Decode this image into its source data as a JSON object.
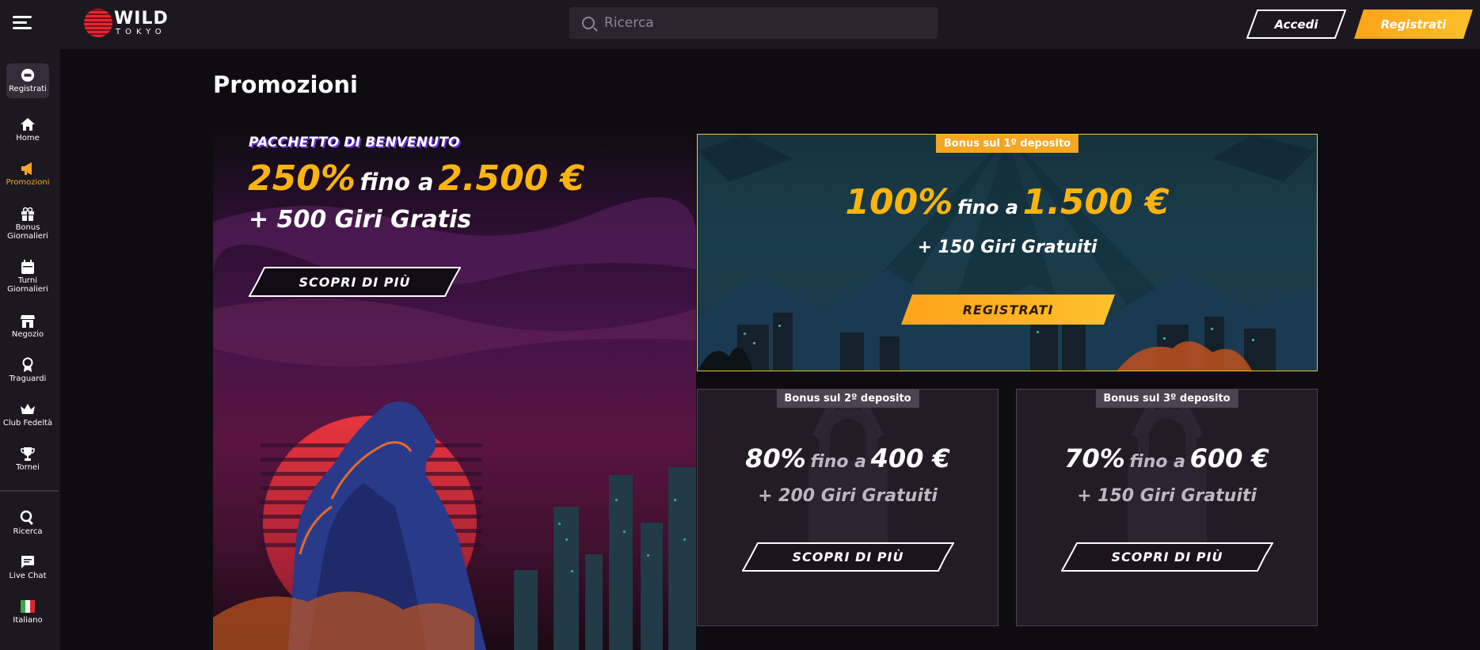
{
  "header": {
    "logo_word": "WILD",
    "logo_sub": "TOKYO",
    "search_placeholder": "Ricerca",
    "login_label": "Accedi",
    "register_label": "Registrati"
  },
  "sidebar": {
    "register_label": "Registrati",
    "items": [
      {
        "label": "Home",
        "icon": "home-icon"
      },
      {
        "label": "Promozioni",
        "icon": "megaphone-icon",
        "active": true
      },
      {
        "label": "Bonus Giornalieri",
        "icon": "gift-icon"
      },
      {
        "label": "Turni Giornalieri",
        "icon": "calendar-icon"
      },
      {
        "label": "Negozio",
        "icon": "shop-icon"
      },
      {
        "label": "Traguardi",
        "icon": "medal-icon"
      },
      {
        "label": "Club Fedeltà",
        "icon": "crown-icon"
      },
      {
        "label": "Tornei",
        "icon": "trophy-icon"
      }
    ],
    "bottom_items": [
      {
        "label": "Ricerca",
        "icon": "search-icon"
      },
      {
        "label": "Live Chat",
        "icon": "chat-icon"
      },
      {
        "label": "Italiano",
        "icon": "italy-flag-icon"
      }
    ]
  },
  "page": {
    "title": "Promozioni"
  },
  "welcome": {
    "kicker": "PACCHETTO DI BENVENUTO",
    "percent": "250%",
    "up_to": "fino a",
    "amount": "2.500 €",
    "spins": "+ 500 Giri Gratis",
    "button": "SCOPRI DI PIÙ"
  },
  "deposits": [
    {
      "badge": "Bonus sul 1º deposito",
      "percent": "100%",
      "up_to": "fino a",
      "amount": "1.500 €",
      "spins": "+ 150 Giri Gratuiti",
      "button": "REGISTRATI"
    },
    {
      "badge": "Bonus sul 2º deposito",
      "percent": "80%",
      "up_to": "fino a",
      "amount": "400 €",
      "spins": "+ 200 Giri Gratuiti",
      "button": "SCOPRI DI PIÙ"
    },
    {
      "badge": "Bonus sul 3º deposito",
      "percent": "70%",
      "up_to": "fino a",
      "amount": "600 €",
      "spins": "+ 150 Giri Gratuiti",
      "button": "SCOPRI DI PIÙ"
    }
  ],
  "colors": {
    "accent": "#f5a623",
    "gold_text": "#fbb40f",
    "header_bg": "#1c1820",
    "page_bg": "#0e0c10"
  }
}
